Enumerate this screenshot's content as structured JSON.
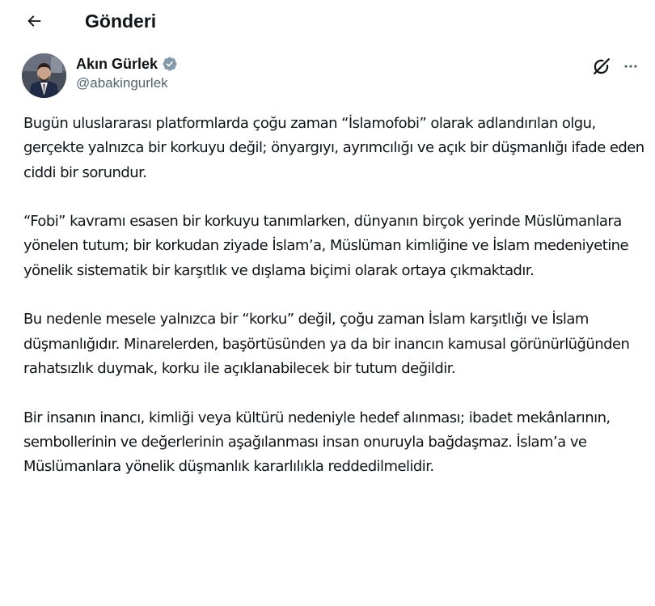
{
  "header": {
    "back_icon": "arrow-left-icon",
    "title": "Gönderi"
  },
  "tweet": {
    "author": {
      "display_name": "Akın Gürlek",
      "handle": "@abakingurlek",
      "verified": true,
      "verified_color": "#829aab",
      "avatar": "avatar-photo"
    },
    "actions": {
      "grok_icon": "grok-icon",
      "more_icon": "more-horizontal-icon"
    },
    "paragraphs": [
      "Bugün uluslararası platformlarda çoğu zaman “İslamofobi” olarak adlandırılan olgu, gerçekte yalnızca bir korkuyu değil; önyargıyı, ayrımcılığı ve açık bir düşmanlığı ifade eden ciddi bir sorundur.",
      "“Fobi” kavramı esasen bir korkuyu tanımlarken, dünyanın birçok yerinde Müslümanlara yönelen tutum; bir korkudan ziyade İslam’a, Müslüman kimliğine ve İslam medeniyetine yönelik sistematik bir karşıtlık ve dışlama biçimi olarak ortaya çıkmaktadır.",
      "Bu nedenle mesele yalnızca bir “korku” değil, çoğu zaman İslam karşıtlığı ve İslam düşmanlığıdır. Minarelerden, başörtüsünden ya da bir inancın kamusal görünürlüğünden rahatsızlık duymak, korku ile açıklanabilecek bir tutum değildir.",
      "Bir insanın inancı, kimliği veya kültürü nedeniyle hedef alınması; ibadet mekânlarının, sembollerinin ve değerlerinin aşağılanması insan onuruyla bağdaşmaz. İslam’a ve Müslümanlara yönelik düşmanlık kararlılıkla reddedilmelidir."
    ]
  }
}
